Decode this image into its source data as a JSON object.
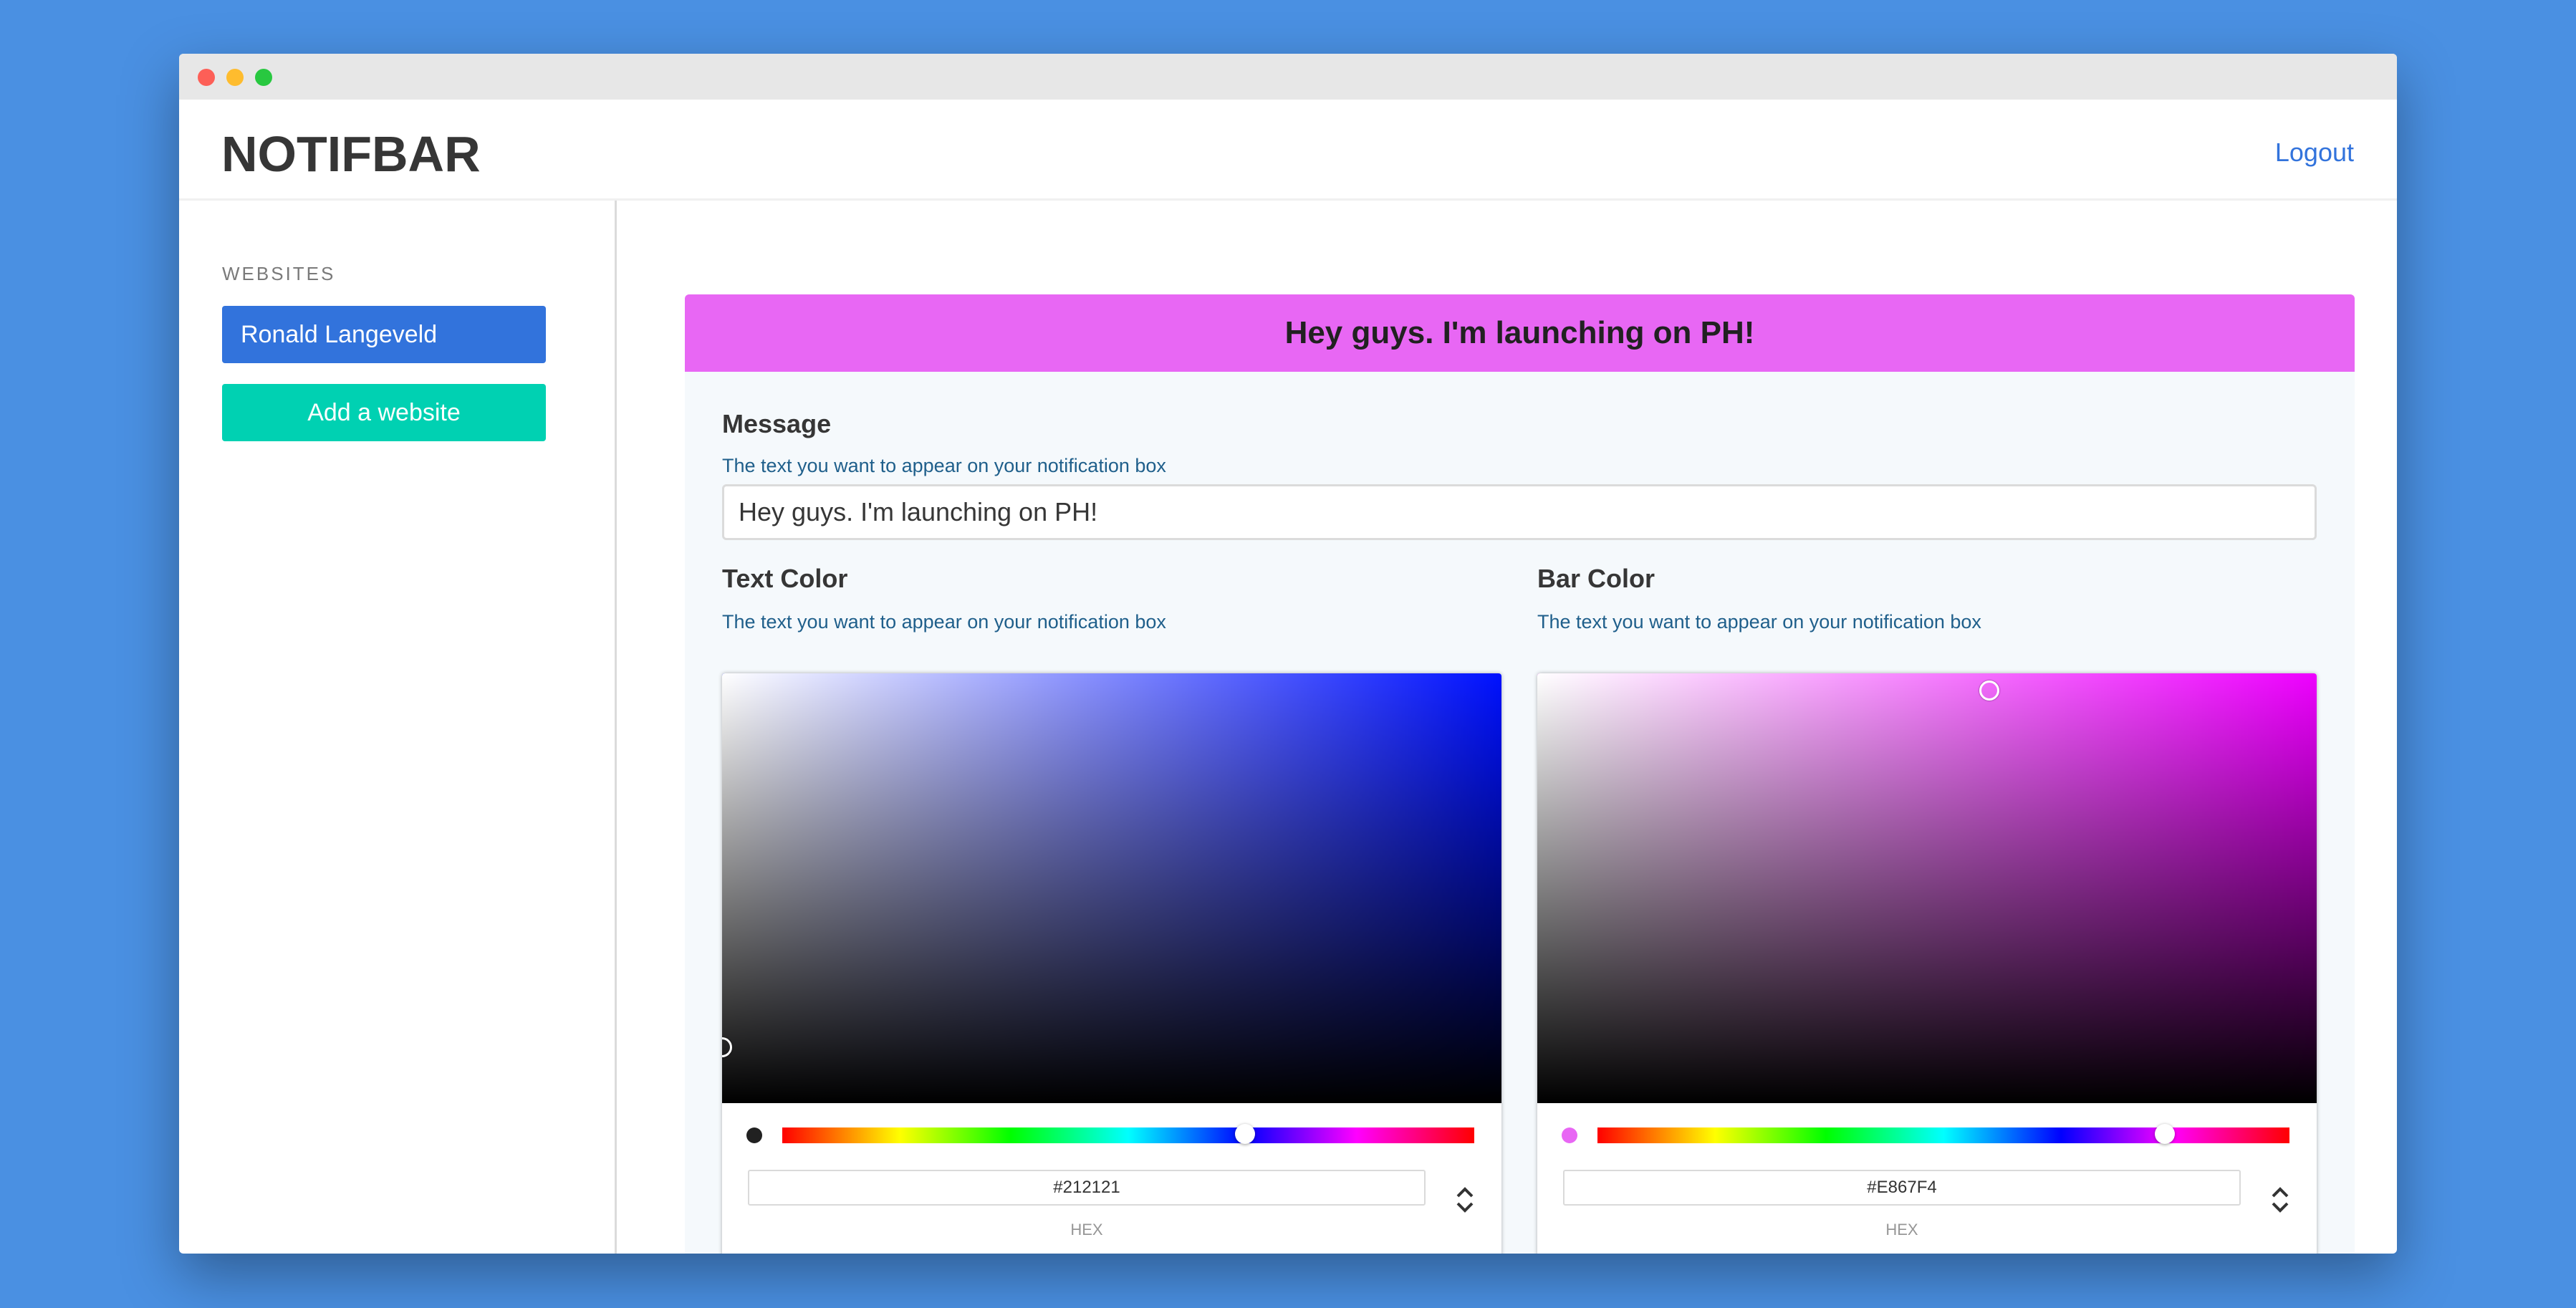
{
  "app": {
    "brand": "NOTIFBAR",
    "logout_label": "Logout"
  },
  "sidebar": {
    "section_label": "WEBSITES",
    "items": [
      {
        "label": "Ronald Langeveld"
      }
    ],
    "add_label": "Add a website"
  },
  "preview": {
    "text": "Hey guys. I'm launching on PH!",
    "text_color": "#212121",
    "bar_color": "#E867F4"
  },
  "message_field": {
    "title": "Message",
    "help": "The text you want to appear on your notification box",
    "value": "Hey guys. I'm launching on PH!"
  },
  "text_color_field": {
    "title": "Text Color",
    "help": "The text you want to appear on your notification box",
    "hex": "#212121",
    "hex_label": "HEX",
    "hue_color": "#0011ff",
    "hue_fraction": 0.669,
    "saturation": 0.0,
    "value": 0.13,
    "icons": {
      "toggle": "chevron-up-down-icon"
    }
  },
  "bar_color_field": {
    "title": "Bar Color",
    "help": "The text you want to appear on your notification box",
    "hex": "#E867F4",
    "hex_label": "HEX",
    "hue_color": "#ee00ff",
    "hue_fraction": 0.82,
    "saturation": 0.58,
    "value": 0.96,
    "icons": {
      "toggle": "chevron-up-down-icon"
    }
  }
}
